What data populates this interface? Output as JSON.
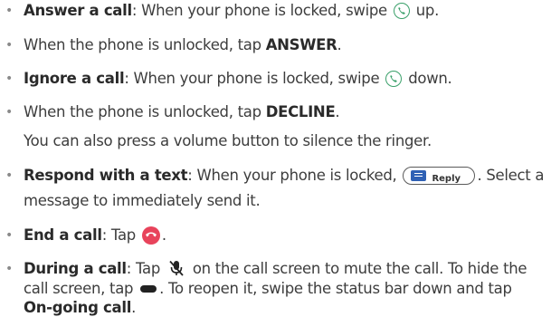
{
  "items": [
    {
      "bold": "Answer a call",
      "text_a": ": When your phone is locked, swipe ",
      "text_b": " up."
    },
    {
      "text": "When the phone is unlocked, tap ",
      "bold_end": "ANSWER",
      "end": "."
    },
    {
      "bold": "Ignore a call",
      "text_a": ": When your phone is locked, swipe ",
      "text_b": " down."
    },
    {
      "text": "When the phone is unlocked, tap ",
      "bold_end": "DECLINE",
      "end": ".",
      "note": "You can also press a volume button to silence the ringer."
    },
    {
      "bold": "Respond with a text",
      "text_a": ": When your phone is locked, ",
      "reply_label": "Reply",
      "text_b": ". Select a",
      "cont": "message to immediately send it."
    },
    {
      "bold": "End a call",
      "text_a": ": Tap ",
      "text_b": "."
    },
    {
      "bold": "During a call",
      "text_a": ": Tap ",
      "text_b": " on the call screen to mute the call. To hide the",
      "cont1_a": "call screen, tap ",
      "cont1_b": ". To reopen it, swipe the status bar down and tap",
      "cont2_bold": "On-going call",
      "cont2_end": "."
    }
  ],
  "icons": {
    "answer": "phone-answer-icon",
    "reply": "reply-message-icon",
    "end_call": "end-call-icon",
    "mute": "microphone-mute-icon",
    "hide": "hide-bar-icon"
  },
  "colors": {
    "phone_green": "#3aa06a",
    "end_red": "#e8435b",
    "reply_blue": "#2f61b5"
  }
}
